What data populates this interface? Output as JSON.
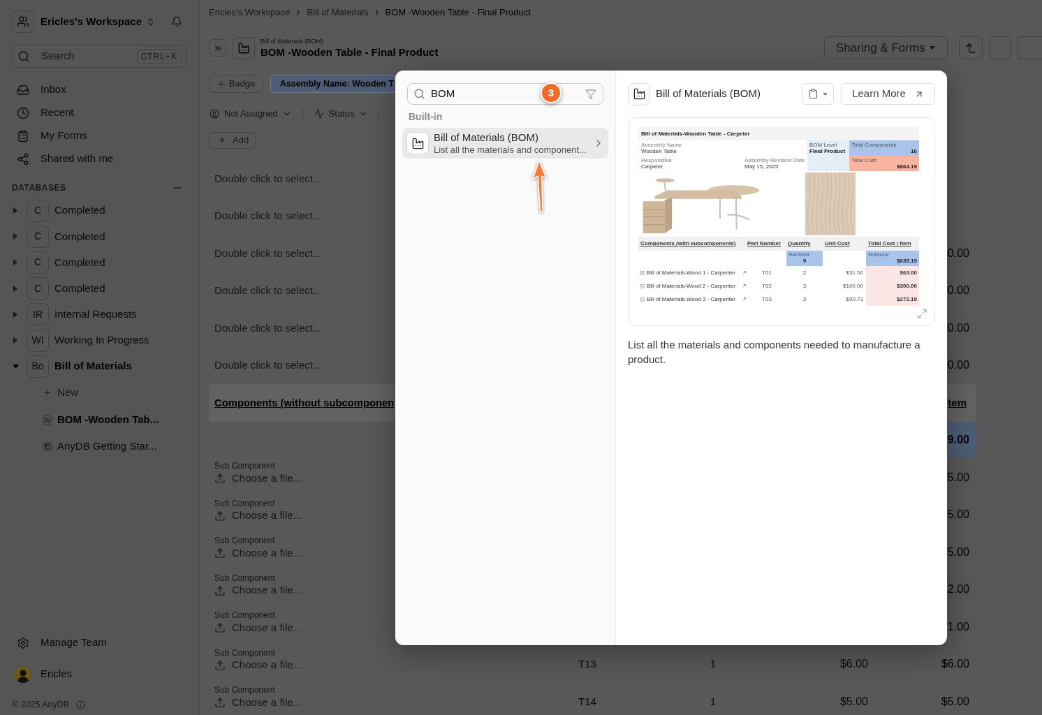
{
  "sidebar": {
    "workspace": "Ericles's Workspace",
    "search": {
      "placeholder": "Search",
      "shortcut": "CTRL+K"
    },
    "nav": [
      {
        "label": "Inbox"
      },
      {
        "label": "Recent"
      },
      {
        "label": "My Forms"
      },
      {
        "label": "Shared with me"
      }
    ],
    "databases_label": "DATABASES",
    "databases": [
      {
        "initials": "C",
        "name": "Completed",
        "expanded": false
      },
      {
        "initials": "C",
        "name": "Completed",
        "expanded": false
      },
      {
        "initials": "C",
        "name": "Completed",
        "expanded": false
      },
      {
        "initials": "C",
        "name": "Completed",
        "expanded": false
      },
      {
        "initials": "IR",
        "name": "Internal Requests",
        "expanded": false
      },
      {
        "initials": "WI",
        "name": "Working In Progress",
        "expanded": false
      },
      {
        "initials": "Bo",
        "name": "Bill of Materials",
        "expanded": true,
        "children": [
          {
            "kind": "new",
            "label": "New",
            "selected": false
          },
          {
            "kind": "report",
            "label": "BOM -Wooden Tab...",
            "selected": true
          },
          {
            "kind": "table",
            "label": "AnyDB Getting Star...",
            "selected": false
          }
        ]
      }
    ],
    "manage_team": "Manage Team",
    "user": "Ericles",
    "copyright": "© 2025 AnyDB"
  },
  "header": {
    "breadcrumb": [
      {
        "label": "Ericles's Workspace",
        "current": false
      },
      {
        "label": "Bill of Materials",
        "current": false
      },
      {
        "label": "BOM -Wooden Table - Final Product",
        "current": true
      }
    ],
    "subtitle": "Bill of Materials (BOM)",
    "title": "BOM -Wooden Table - Final Product",
    "share_button": "Sharing & Forms"
  },
  "toolbar": {
    "badge_button": "Badge",
    "badges": [
      "Assembly Name: Wooden T"
    ],
    "filters": [
      {
        "kind": "assignee",
        "label": "Not Assigned"
      },
      {
        "kind": "status",
        "label": "Status"
      }
    ],
    "add_button": "Add"
  },
  "table": {
    "rows": [
      {
        "kind": "select",
        "placeholder": "Double click to select..."
      },
      {
        "kind": "select",
        "placeholder": "Double click to select..."
      },
      {
        "kind": "select",
        "placeholder": "Double click to select...",
        "total": "0.00"
      },
      {
        "kind": "select",
        "placeholder": "Double click to select...",
        "total": "0.00"
      },
      {
        "kind": "select",
        "placeholder": "Double click to select...",
        "total": "0.00"
      },
      {
        "kind": "select",
        "placeholder": "Double click to select...",
        "total": "0.00"
      },
      {
        "kind": "heading",
        "label": "Components (without subcomponen",
        "total": "tem"
      },
      {
        "kind": "subtotal",
        "total": "9.00"
      },
      {
        "kind": "upload",
        "label": "Sub Component",
        "action": "Choose a file...",
        "total": "5.00"
      },
      {
        "kind": "upload",
        "label": "Sub Component",
        "action": "Choose a file...",
        "total": "5.00"
      },
      {
        "kind": "upload",
        "label": "Sub Component",
        "action": "Choose a file...",
        "total": "5.00"
      },
      {
        "kind": "upload",
        "label": "Sub Component",
        "action": "Choose a file...",
        "total": "2.00"
      },
      {
        "kind": "upload",
        "label": "Sub Component",
        "action": "Choose a file...",
        "total": "1.00"
      },
      {
        "kind": "upload",
        "label": "Sub Component",
        "action": "Choose a file...",
        "part": "T13",
        "quantity": "1",
        "unit_cost": "$6.00",
        "total": "$6.00"
      },
      {
        "kind": "upload",
        "label": "Sub Component",
        "action": "Choose a file...",
        "part": "T14",
        "quantity": "1",
        "unit_cost": "$5.00",
        "total": "$5.00"
      }
    ]
  },
  "dialog": {
    "search": {
      "value": "BOM"
    },
    "step_marker": "3",
    "group_label": "Built-in",
    "results": [
      {
        "title": "Bill of Materials (BOM)",
        "description": "List all the materials and component...",
        "selected": true
      }
    ],
    "preview": {
      "title": "Bill of Materials (BOM)",
      "learn_more": "Learn More",
      "document": {
        "title": "Bill of Materials-Wooden Table - Carpeter",
        "fields": [
          {
            "label": "Assembly Name",
            "value": "Wooden Table"
          },
          {
            "label": "Responsible",
            "value": "Carpeter"
          },
          {
            "label": "Assembly Revision Date",
            "value": "May 15, 2025"
          }
        ],
        "summary": [
          {
            "label": "BOM Level",
            "value": "Final Product",
            "color": "#e3eef6"
          },
          {
            "label": "Total Components",
            "value": "16",
            "color": "#a9c4ea"
          },
          {
            "label": "Total Cost",
            "value": "$864.19",
            "color": "#f9b3a1"
          }
        ],
        "columns": [
          "Components (with subcomponents)",
          "Part Number",
          "Quantity",
          "Unit Cost",
          "Total Cost / Item"
        ],
        "subtotals": [
          {
            "label": "Subtotal",
            "value": "9"
          },
          {
            "label": "Subtotal",
            "value": "$635.19"
          }
        ],
        "rows": [
          {
            "name": "Bill of Materials-Wood 1 - Carpenter",
            "part": "T01",
            "quantity": "2",
            "unit_cost": "$31.50",
            "total": "$63.00"
          },
          {
            "name": "Bill of Materials-Wood 2 - Carpenter",
            "part": "T02",
            "quantity": "3",
            "unit_cost": "$100.00",
            "total": "$300.00"
          },
          {
            "name": "Bill of Materials-Wood 3 - Carpenter",
            "part": "T03",
            "quantity": "3",
            "unit_cost": "$90.73",
            "total": "$272.19"
          }
        ]
      },
      "description": "List all the materials and components needed to manufacture a product."
    }
  }
}
